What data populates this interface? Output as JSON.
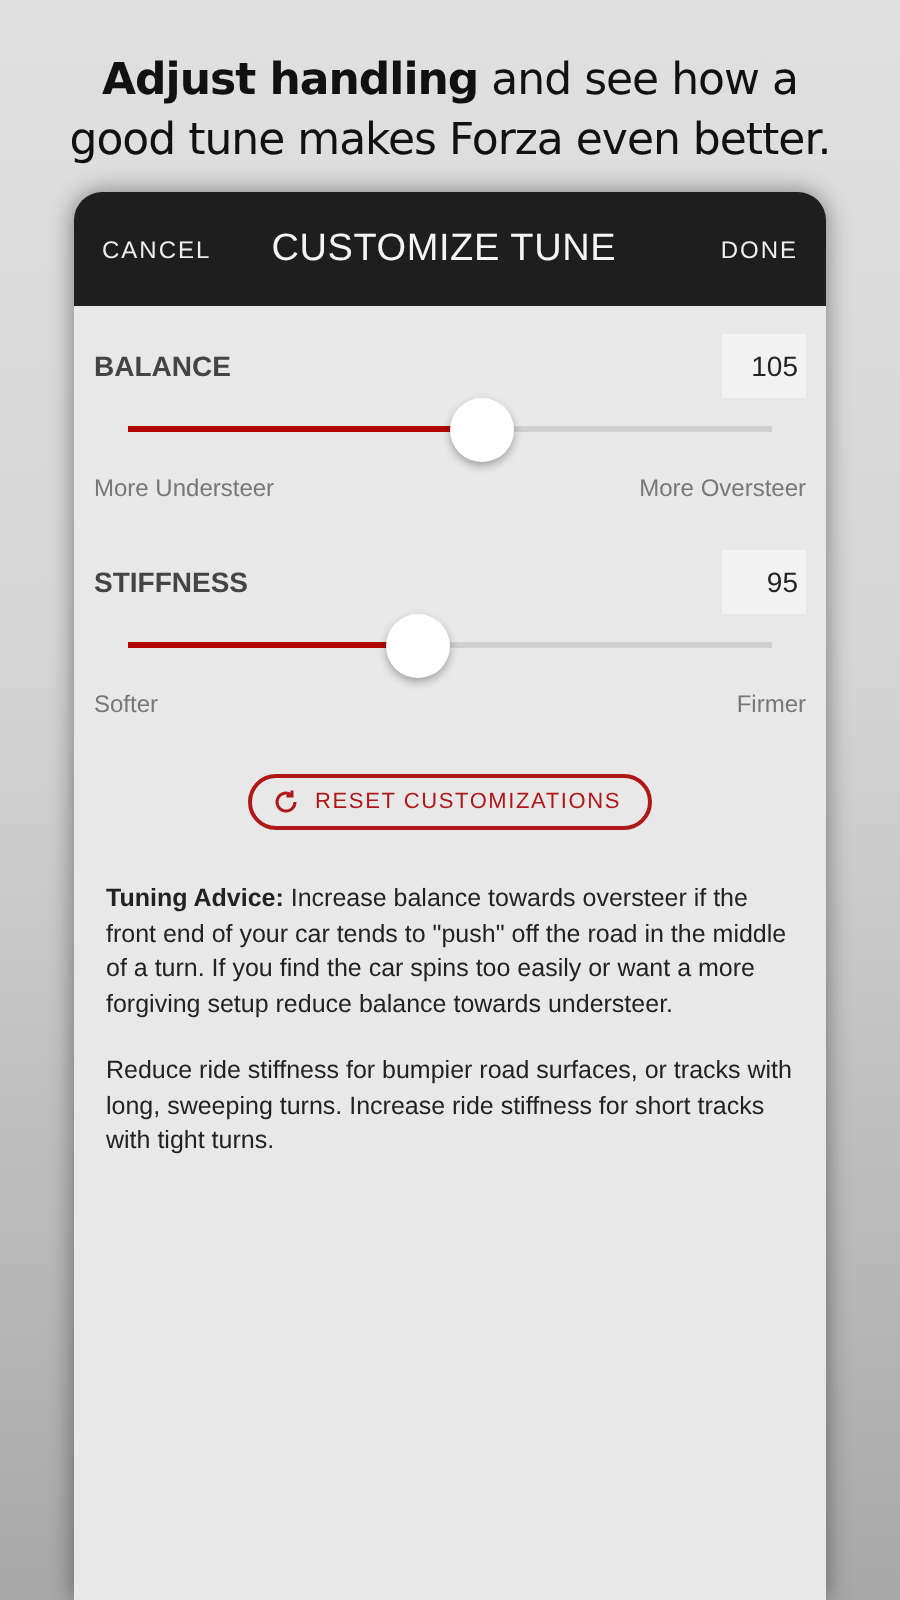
{
  "headline": "**Adjust handling** and see how a good tune makes Forza even better.",
  "header": {
    "cancel": "CANCEL",
    "title": "CUSTOMIZE TUNE",
    "done": "DONE"
  },
  "sliders": [
    {
      "label": "BALANCE",
      "value": "105",
      "level": 0.55,
      "min_label": "More Understeer",
      "max_label": "More Oversteer"
    },
    {
      "label": "STIFFNESS",
      "value": "95",
      "level": 0.45,
      "min_label": "Softer",
      "max_label": "Firmer"
    }
  ],
  "reset_button": "RESET CUSTOMIZATIONS",
  "advice": [
    "**Tuning Advice:** Increase balance towards oversteer if the front end of your car tends to \"push\" off the road in the middle of a turn. If you find the car spins too easily or want a more forgiving setup reduce balance towards understeer.",
    "Reduce ride stiffness for bumpier road surfaces, or tracks with long, sweeping turns. Increase ride stiffness for short tracks with tight turns."
  ]
}
